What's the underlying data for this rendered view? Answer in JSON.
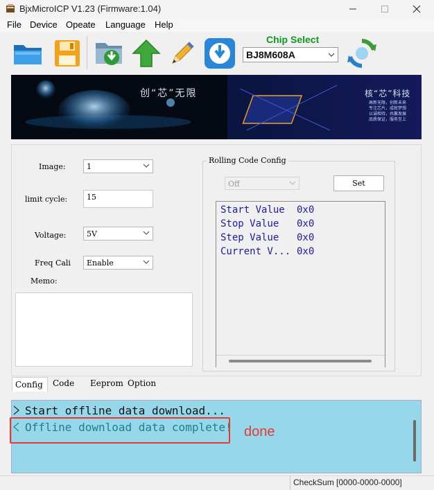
{
  "window": {
    "title": "BjxMicroICP V1.23 (Firmware:1.04)"
  },
  "menu": [
    "File",
    "Device",
    "Opeate",
    "Language",
    "Help"
  ],
  "toolbar": {
    "chip_label": "Chip Select",
    "chip_value": "BJ8M608A"
  },
  "banner": {
    "text_left": "创“芯”无限",
    "text_right": "核“芯”科技",
    "caption": [
      "高新无限，创新未来",
      "专注芯片，成就梦想",
      "以诚相待，共赢发展",
      "品质保证，服务至上"
    ]
  },
  "config": {
    "image_label": "Image:",
    "image_value": "1",
    "limit_label": "limit cycle:",
    "limit_value": "15",
    "voltage_label": "Voltage:",
    "voltage_value": "5V",
    "freq_label": "Freq Cali",
    "freq_value": "Enable",
    "memo_label": "Memo:",
    "memo_value": ""
  },
  "rolling": {
    "title": "Rolling Code Config",
    "select_value": "Off",
    "set_label": "Set",
    "rows": [
      {
        "name": "Start Value",
        "value": "0x0"
      },
      {
        "name": "Stop Value",
        "value": "0x0"
      },
      {
        "name": "Step Value",
        "value": "0x0"
      },
      {
        "name": "Current V...",
        "value": "0x0"
      }
    ]
  },
  "tabs": [
    "Config",
    "Code",
    "Eeprom",
    "Option"
  ],
  "log": {
    "lines": [
      "Start offline data download...",
      "Offline download data complete!"
    ],
    "annotation": "done"
  },
  "status": {
    "checksum": "CheckSum [0000-0000-0000]"
  },
  "colors": {
    "log_bg": "#96d8ea",
    "chip_label": "#0c9a20",
    "annotation_red": "#e53935",
    "rc_text": "#1d1aa8"
  }
}
